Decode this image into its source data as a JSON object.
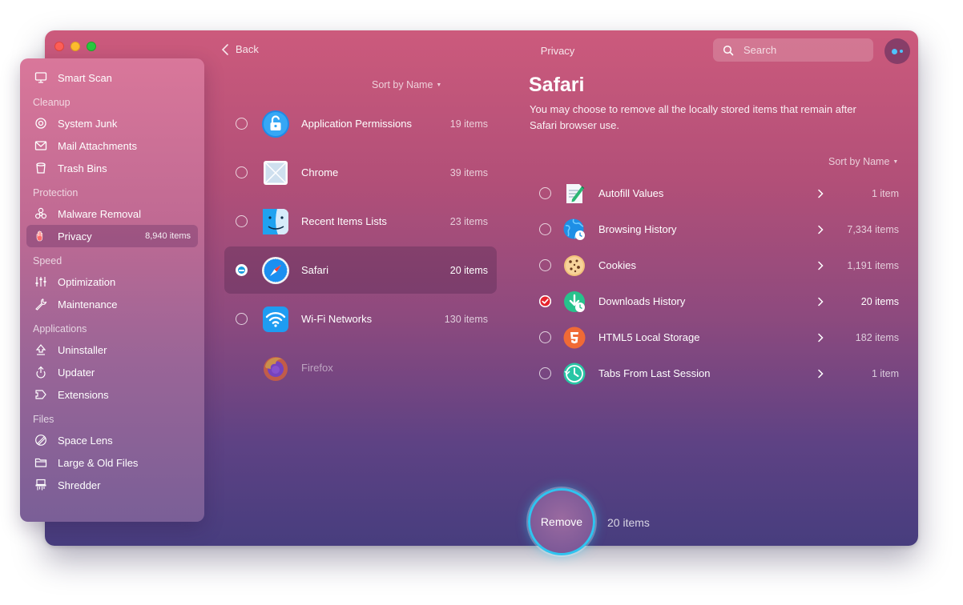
{
  "window": {
    "title": "Privacy"
  },
  "topbar": {
    "back_label": "Back",
    "search_placeholder": "Search"
  },
  "sidebar": {
    "smart_scan": "Smart Scan",
    "sections": {
      "cleanup": "Cleanup",
      "protection": "Protection",
      "speed": "Speed",
      "applications": "Applications",
      "files": "Files"
    },
    "items": {
      "system_junk": "System Junk",
      "mail_attachments": "Mail Attachments",
      "trash_bins": "Trash Bins",
      "malware_removal": "Malware Removal",
      "privacy": "Privacy",
      "privacy_count": "8,940 items",
      "optimization": "Optimization",
      "maintenance": "Maintenance",
      "uninstaller": "Uninstaller",
      "updater": "Updater",
      "extensions": "Extensions",
      "space_lens": "Space Lens",
      "large_old_files": "Large & Old Files",
      "shredder": "Shredder"
    }
  },
  "apps": {
    "sort_label": "Sort by Name",
    "list": [
      {
        "name": "Application Permissions",
        "count": "19 items",
        "icon": "lock-icon"
      },
      {
        "name": "Chrome",
        "count": "39 items",
        "icon": "chrome-icon"
      },
      {
        "name": "Recent Items Lists",
        "count": "23 items",
        "icon": "finder-icon"
      },
      {
        "name": "Safari",
        "count": "20 items",
        "icon": "safari-icon"
      },
      {
        "name": "Wi-Fi Networks",
        "count": "130 items",
        "icon": "wifi-icon"
      },
      {
        "name": "Firefox",
        "count": "",
        "icon": "firefox-icon"
      }
    ]
  },
  "detail": {
    "title": "Safari",
    "description": "You may choose to remove all the locally stored items that remain after Safari browser use.",
    "sort_label": "Sort by Name",
    "items": [
      {
        "name": "Autofill Values",
        "count": "1 item",
        "icon": "autofill-icon"
      },
      {
        "name": "Browsing History",
        "count": "7,334 items",
        "icon": "globe-history-icon"
      },
      {
        "name": "Cookies",
        "count": "1,191 items",
        "icon": "cookie-icon"
      },
      {
        "name": "Downloads History",
        "count": "20 items",
        "icon": "download-icon"
      },
      {
        "name": "HTML5 Local Storage",
        "count": "182 items",
        "icon": "html5-icon"
      },
      {
        "name": "Tabs From Last Session",
        "count": "1 item",
        "icon": "clock-icon"
      }
    ]
  },
  "footer": {
    "remove_label": "Remove",
    "remove_count": "20 items"
  },
  "colors": {
    "accent": "#2fc4f0",
    "check_red": "#e5242e"
  }
}
